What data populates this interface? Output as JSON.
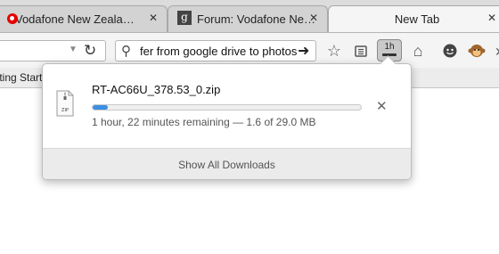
{
  "tabs": [
    {
      "title": "Vodafone New Zeala…",
      "icon": "vodafone-icon",
      "close": "✕"
    },
    {
      "title": "Forum: Vodafone Ne…",
      "icon": "g-favicon",
      "icon_char": "g",
      "close": "✕"
    },
    {
      "title": "New Tab",
      "active": true,
      "close": "✕"
    }
  ],
  "search": {
    "value": "fer from google drive to photos"
  },
  "toolbar": {
    "download_button_text": "1h"
  },
  "bookmarks": {
    "item": "tting Starte"
  },
  "download": {
    "file_name": "RT-AC66U_378.53_0.zip",
    "file_icon_label": "ZIP",
    "progress_fraction": 0.055,
    "status": "1 hour, 22 minutes remaining — 1.6 of 29.0 MB",
    "show_all": "Show All Downloads"
  },
  "colors": {
    "progress": "#3c8fe3",
    "vodafone": "#e60000"
  }
}
